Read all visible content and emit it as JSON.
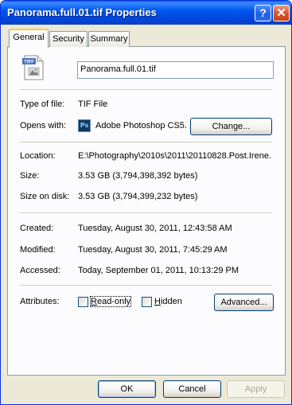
{
  "window": {
    "title": "Panorama.full.01.tif Properties"
  },
  "titlebar_buttons": {
    "help": "?",
    "close": "✕"
  },
  "tabs": [
    {
      "label": "General",
      "active": true
    },
    {
      "label": "Security",
      "active": false
    },
    {
      "label": "Summary",
      "active": false
    }
  ],
  "file": {
    "icon": "tif-file-icon",
    "icon_badge": "TIFF",
    "name": "Panorama.full.01.tif"
  },
  "type": {
    "label": "Type of file:",
    "value": "TIF File"
  },
  "opens_with": {
    "label": "Opens with:",
    "app_icon": "photoshop-icon",
    "app_icon_text": "Ps",
    "value": "Adobe Photoshop CS5.",
    "change_button": "Change..."
  },
  "location": {
    "label": "Location:",
    "value": "E:\\Photography\\2010s\\2011\\20110828.Post.Irene."
  },
  "size": {
    "label": "Size:",
    "value": "3.53 GB (3,794,398,392 bytes)"
  },
  "size_on_disk": {
    "label": "Size on disk:",
    "value": "3.53 GB (3,794,399,232 bytes)"
  },
  "created": {
    "label": "Created:",
    "value": "Tuesday, August 30, 2011, 12:43:58 AM"
  },
  "modified": {
    "label": "Modified:",
    "value": "Tuesday, August 30, 2011, 7:45:29 AM"
  },
  "accessed": {
    "label": "Accessed:",
    "value": "Today, September 01, 2011, 10:13:29 PM"
  },
  "attributes": {
    "label": "Attributes:",
    "readonly": {
      "label": "Read-only",
      "checked": false
    },
    "hidden": {
      "label": "Hidden",
      "checked": false
    },
    "advanced_button": "Advanced..."
  },
  "footer": {
    "ok": "OK",
    "cancel": "Cancel",
    "apply": "Apply"
  }
}
